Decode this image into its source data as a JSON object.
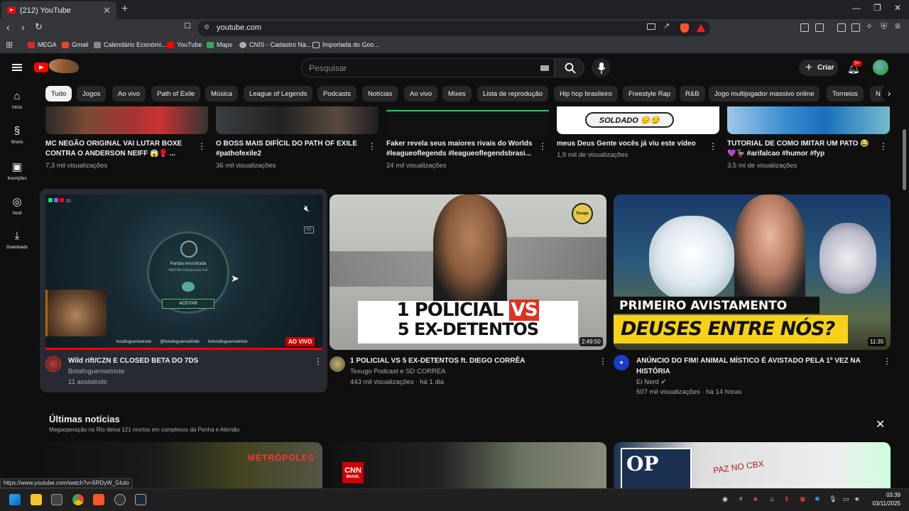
{
  "browser": {
    "tab_title": "(212) YouTube",
    "url": "youtube.com",
    "bookmarks": [
      "MEGA",
      "Gmail",
      "Calendário Económi...",
      "YouTube",
      "Maps",
      "CNIS - Cadastro Na...",
      "Importada do Goo..."
    ],
    "status_url": "https://www.youtube.com/watch?v=5RDyW_GIuto"
  },
  "youtube": {
    "search_placeholder": "Pesquisar",
    "create_label": "Criar",
    "notif_count": "9+",
    "sidebar": [
      "Início",
      "Shorts",
      "Inscrições",
      "Você",
      "Downloads"
    ],
    "chips": [
      "Tudo",
      "Jogos",
      "Ao vivo",
      "Path of Exile",
      "Música",
      "League of Legends",
      "Podcasts",
      "Notícias",
      "Ao vivo",
      "Mixes",
      "Lista de reprodução",
      "Hip hop brasileiro",
      "Freestyle Rap",
      "R&B",
      "Jogo multijogador massivo online",
      "Torneios",
      "N"
    ],
    "top_row": [
      {
        "title1": "MC NEGÃO ORIGINAL VAI LUTAR BOXE",
        "title2": "CONTRA O ANDERSON NEIFF 😱🥊 ...",
        "meta": "7,3 mil visualizações"
      },
      {
        "title1": "O BOSS MAIS DIFÍCIL DO PATH OF EXILE",
        "title2": "#pathofexile2",
        "meta": "36 mil visualizações"
      },
      {
        "title1": "Faker revela seus maiores rivais do Worlds",
        "title2": "#leagueoflegends #leagueoflegendsbrasi...",
        "meta": "24 mil visualizações"
      },
      {
        "title1": "meus Deus Gente vocês já viu este vídeo",
        "title2": "",
        "meta": "1,9 mil de visualizações",
        "thumb_text": "SOLDADO 😔😏"
      },
      {
        "title1": "TUTORIAL DE COMO IMITAR UM PATO 😂",
        "title2": "💜🦆 #arifalcao #humor #fyp",
        "meta": "3,5 mi de visualizações"
      }
    ],
    "main_row": [
      {
        "title1": "Wild rift/CZN E CLOSED BETA DO 7DS",
        "title2": "",
        "channel": "Botafoguensetriste",
        "meta": "11 assistindo",
        "badge": "AO VIVO",
        "overlay": {
          "match": "Partida encontrada",
          "mode": "Wild Rift Ranqueada 5v5",
          "accept": "ACEITAR",
          "social1": "botafoguensetriste",
          "social2": "@botafoguensetriste",
          "social3": "ttvbotafoguensetriste",
          "counter": "20"
        }
      },
      {
        "title1": "1 POLICIAL VS 5 EX-DETENTOS ft. DIEGO CORRÊA",
        "title2": "",
        "channel": "Texugo Podcast e SD CORREA",
        "meta": "443 mil visualizações · há 1 dia",
        "duration": "2:49:50",
        "thumb_line1a": "1 POLICIAL ",
        "thumb_line1b": "VS",
        "thumb_line2": "5 EX-DETENTOS",
        "logo_text": "Texugo"
      },
      {
        "title1": "ANÚNCIO DO FIM! ANIMAL MÍSTICO É AVISTADO PELA 1º VEZ NA",
        "title2": "HISTÓRIA",
        "channel": "Ei Nerd",
        "meta": "507 mil visualizações · há 14 horas",
        "duration": "11:35",
        "thumb_line1": "PRIMEIRO AVISTAMENTO",
        "thumb_line2": "DEUSES ENTRE NÓS?"
      }
    ],
    "news": {
      "heading": "Últimas notícias",
      "sub": "Megaoperação no Rio deixa 121 mortos em complexos da Penha e Alemão",
      "thumbs": [
        {
          "brand": "METRÓPOLES"
        },
        {
          "brand": "CNN",
          "brand_sub": "BRASIL"
        },
        {
          "brand": "OP",
          "sign": "PAZ NO CBX"
        }
      ]
    }
  },
  "taskbar": {
    "time": "03:39",
    "date": "03/11/2025"
  },
  "colors": {
    "bg": "#0f0f0f",
    "chip": "#272727",
    "live": "#cc0000",
    "accent": "#ff0000"
  }
}
